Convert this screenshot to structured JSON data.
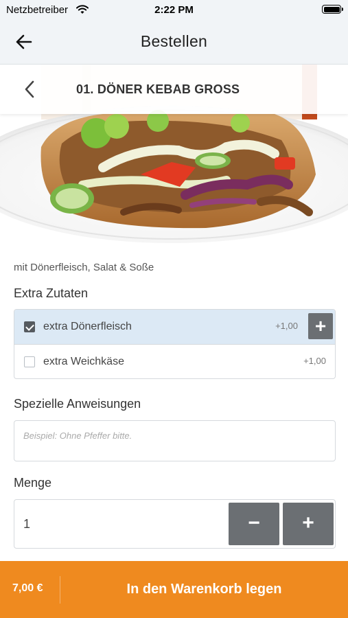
{
  "status_bar": {
    "carrier": "Netzbetreiber",
    "time": "2:22 PM",
    "icons": [
      "wifi-icon",
      "battery-icon"
    ]
  },
  "nav": {
    "title": "Bestellen",
    "back_icon": "arrow-left-icon"
  },
  "product": {
    "title": "01. DÖNER KEBAB GROSS",
    "back_icon": "chevron-left-icon",
    "image": "doner-kebab-photo",
    "description": "mit Dönerfleisch, Salat & Soße"
  },
  "extras": {
    "label": "Extra Zutaten",
    "items": [
      {
        "name": "extra Dönerfleisch",
        "price": "+1,00",
        "checked": true,
        "add_label": "+"
      },
      {
        "name": "extra Weichkäse",
        "price": "+1,00",
        "checked": false
      }
    ]
  },
  "instructions": {
    "label": "Spezielle Anweisungen",
    "placeholder": "Beispiel: Ohne Pfeffer bitte.",
    "value": ""
  },
  "quantity": {
    "label": "Menge",
    "value": "1",
    "decrement_label": "−",
    "increment_label": "+"
  },
  "cart": {
    "total": "7,00 €",
    "button_label": "In den Warenkorb legen"
  },
  "colors": {
    "accent_orange": "#ef8a1f",
    "button_grey": "#6b6f73",
    "selected_row": "#dce9f5",
    "nav_background": "#f1f4f7"
  }
}
